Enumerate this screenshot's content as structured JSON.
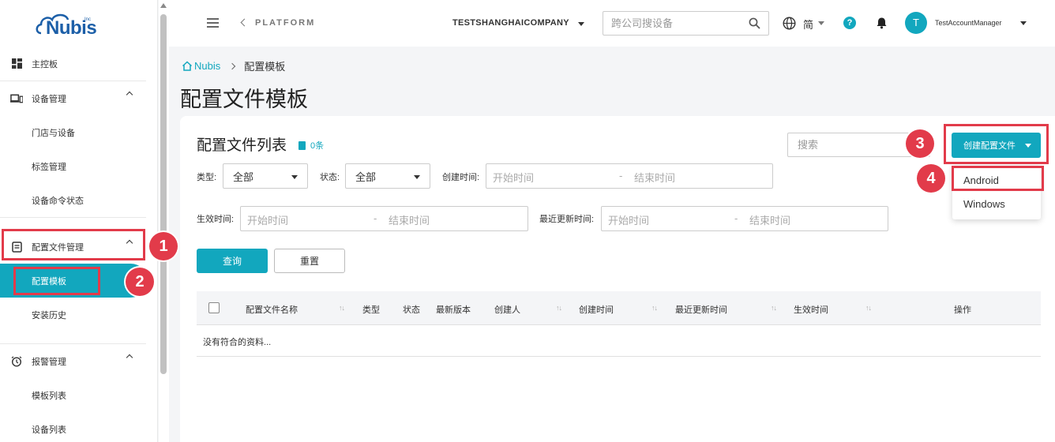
{
  "brand": {
    "logo_text": "Nubis",
    "logo_small": "Inc"
  },
  "sidebar": {
    "items": [
      {
        "label": "主控板",
        "icon": "dashboard-icon"
      },
      {
        "label": "设备管理",
        "icon": "devices-icon"
      },
      {
        "label": "门店与设备"
      },
      {
        "label": "标签管理"
      },
      {
        "label": "设备命令状态"
      },
      {
        "label": "配置文件管理",
        "icon": "config-file-icon"
      },
      {
        "label": "配置模板"
      },
      {
        "label": "安装历史"
      },
      {
        "label": "报警管理",
        "icon": "alarm-clock-icon"
      },
      {
        "label": "模板列表"
      },
      {
        "label": "设备列表"
      }
    ]
  },
  "topbar": {
    "platform": "PLATFORM",
    "company": "TESTSHANGHAICOMPANY",
    "search_placeholder": "跨公司搜设备",
    "lang": "简",
    "help": "?",
    "avatar_initial": "T",
    "username": "TestAccountManager"
  },
  "breadcrumb": {
    "home": "Nubis",
    "current": "配置模板"
  },
  "page_title": "配置文件模板",
  "card": {
    "title": "配置文件列表",
    "count": "0条",
    "search_placeholder": "搜索",
    "filters": {
      "type_label": "类型:",
      "type_value": "全部",
      "status_label": "状态:",
      "status_value": "全部",
      "created_label": "创建时间:",
      "effective_label": "生效时间:",
      "updated_label": "最近更新时间:",
      "start_placeholder": "开始时间",
      "end_placeholder": "结束时间",
      "dash": "-"
    },
    "query_button": "查询",
    "reset_button": "重置",
    "columns": [
      "配置文件名称",
      "类型",
      "状态",
      "最新版本",
      "创建人",
      "创建时间",
      "最近更新时间",
      "生效时间",
      "操作"
    ],
    "sort_glyph": "↑↓",
    "empty_text": "没有符合的资料..."
  },
  "create": {
    "button": "创建配置文件",
    "options": [
      "Android",
      "Windows"
    ]
  },
  "annotations": [
    "1",
    "2",
    "3",
    "4"
  ],
  "colors": {
    "accent": "#12a7be",
    "highlight": "#e23b4a"
  }
}
